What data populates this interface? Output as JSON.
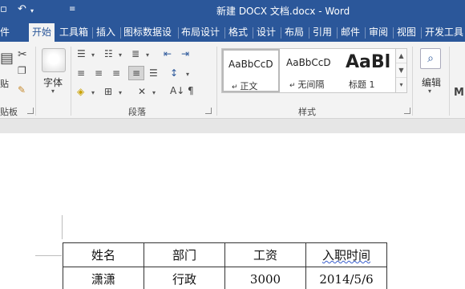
{
  "window": {
    "title": "新建 DOCX 文档.docx - Word"
  },
  "ribbon_tabs": [
    "件",
    "开始",
    "工具箱",
    "插入",
    "图标数据设",
    "布局设计",
    "格式",
    "设计",
    "布局",
    "引用",
    "邮件",
    "审阅",
    "视图",
    "开发工具"
  ],
  "ribbon": {
    "clipboard": {
      "paste_label": "贴",
      "group_label": "贴板"
    },
    "font": {
      "label": "字体"
    },
    "paragraph": {
      "group_label": "段落"
    },
    "styles": {
      "group_label": "样式",
      "items": [
        {
          "sample": "AaBbCcD",
          "name": "正文"
        },
        {
          "sample": "AaBbCcD",
          "name": "无间隔"
        },
        {
          "sample": "AaBl",
          "name": "标题 1"
        }
      ]
    },
    "editing": {
      "label": "编辑"
    }
  },
  "table": {
    "rows": [
      [
        "姓名",
        "部门",
        "工资",
        "入职时间"
      ],
      [
        "潇潇",
        "行政",
        "3000",
        "2014/5/6"
      ]
    ]
  }
}
